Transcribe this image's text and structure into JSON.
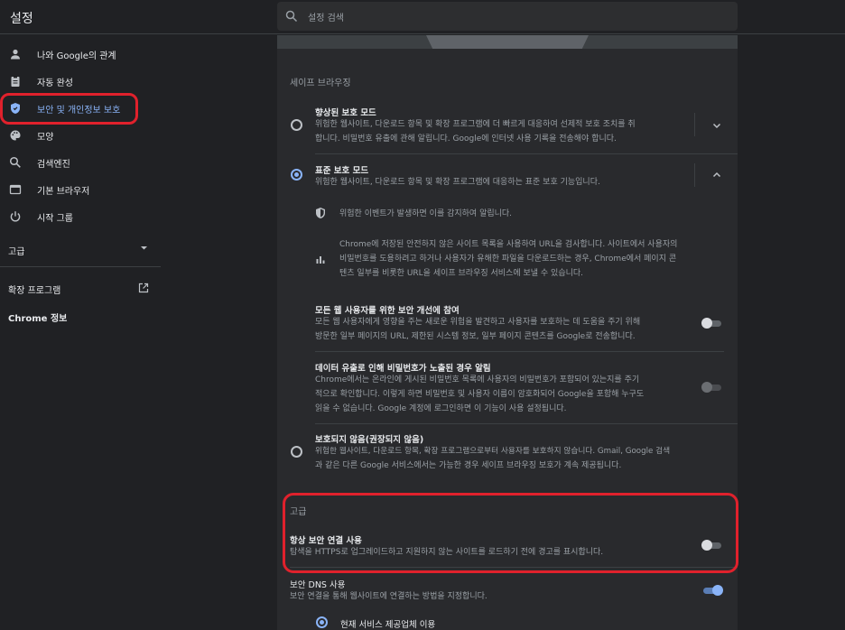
{
  "header": {
    "title": "설정",
    "search_placeholder": "설정 검색"
  },
  "sidebar": {
    "items": [
      {
        "label": "나와 Google의 관계",
        "icon": "person-icon"
      },
      {
        "label": "자동 완성",
        "icon": "clipboard-icon"
      },
      {
        "label": "보안 및 개인정보 보호",
        "icon": "shield-icon",
        "active": true
      },
      {
        "label": "모양",
        "icon": "palette-icon"
      },
      {
        "label": "검색엔진",
        "icon": "search-icon"
      },
      {
        "label": "기본 브라우저",
        "icon": "browser-icon"
      },
      {
        "label": "시작 그룹",
        "icon": "power-icon"
      }
    ],
    "advanced": "고급",
    "extensions": "확장 프로그램",
    "about": "Chrome 정보"
  },
  "main": {
    "safe_browsing_heading": "세이프 브라우징",
    "enhanced": {
      "title": "향상된 보호 모드",
      "desc1": "위험한 웹사이트, 다운로드 항목 및 확장 프로그램에 더 빠르게 대응하여 선제적 보호 조치를 취",
      "desc2": "합니다. 비밀번호 유출에 관해 알립니다. Google에 인터넷 사용 기록을 전송해야 합니다."
    },
    "standard": {
      "title": "표준 보호 모드",
      "desc": "위험한 웹사이트, 다운로드 항목 및 확장 프로그램에 대응하는 표준 보호 기능입니다.",
      "detail1": "위험한 이벤트가 발생하면 이를 감지하여 알립니다.",
      "detail2_l1": "Chrome에 저장된 안전하지 않은 사이트 목록을 사용하여 URL을 검사합니다. 사이트에서 사용자의",
      "detail2_l2": "비밀번호를 도용하려고 하거나 사용자가 유해한 파일을 다운로드하는 경우, Chrome에서 페이지 콘",
      "detail2_l3": "텐츠 일부를 비롯한 URL을 세이프 브라우징 서비스에 보낼 수 있습니다.",
      "improve_title": "모든 웹 사용자를 위한 보안 개선에 참여",
      "improve_l1": "모든 웹 사용자에게 영향을 주는 새로운 위험을 발견하고 사용자를 보호하는 데 도움을 주기 위해",
      "improve_l2": "방문한 일부 페이지의 URL, 제한된 시스템 정보, 일부 페이지 콘텐츠를 Google로 전송합니다.",
      "leak_title": "데이터 유출로 인해 비밀번호가 노출된 경우 알림",
      "leak_l1": "Chrome에서는 온라인에 게시된 비밀번호 목록에 사용자의 비밀번호가 포함되어 있는지를 주기",
      "leak_l2": "적으로 확인합니다. 이렇게 하면 비밀번호 및 사용자 이름이 암호화되어 Google을 포함해 누구도",
      "leak_l3": "읽을 수 없습니다. Google 계정에 로그인하면 이 기능이 사용 설정됩니다."
    },
    "none": {
      "title": "보호되지 않음(권장되지 않음)",
      "desc1": "위험한 웹사이트, 다운로드 항목, 확장 프로그램으로부터 사용자를 보호하지 않습니다. Gmail, Google 검색",
      "desc2": "과 같은 다른 Google 서비스에서는 가능한 경우 세이프 브라우징 보호가 계속 제공됩니다."
    },
    "advanced_heading": "고급",
    "https": {
      "title": "항상 보안 연결 사용",
      "desc": "탐색을 HTTPS로 업그레이드하고 지원하지 않는 사이트를 로드하기 전에 경고를 표시합니다."
    },
    "dns": {
      "title": "보안 DNS 사용",
      "desc": "보안 연결을 통해 웹사이트에 연결하는 방법을 지정합니다.",
      "option": "현재 서비스 제공업체 이용"
    }
  },
  "colors": {
    "accent": "#8ab4f8",
    "highlight_ring": "#e0212c",
    "background": "#202124",
    "card": "#292a2d"
  }
}
